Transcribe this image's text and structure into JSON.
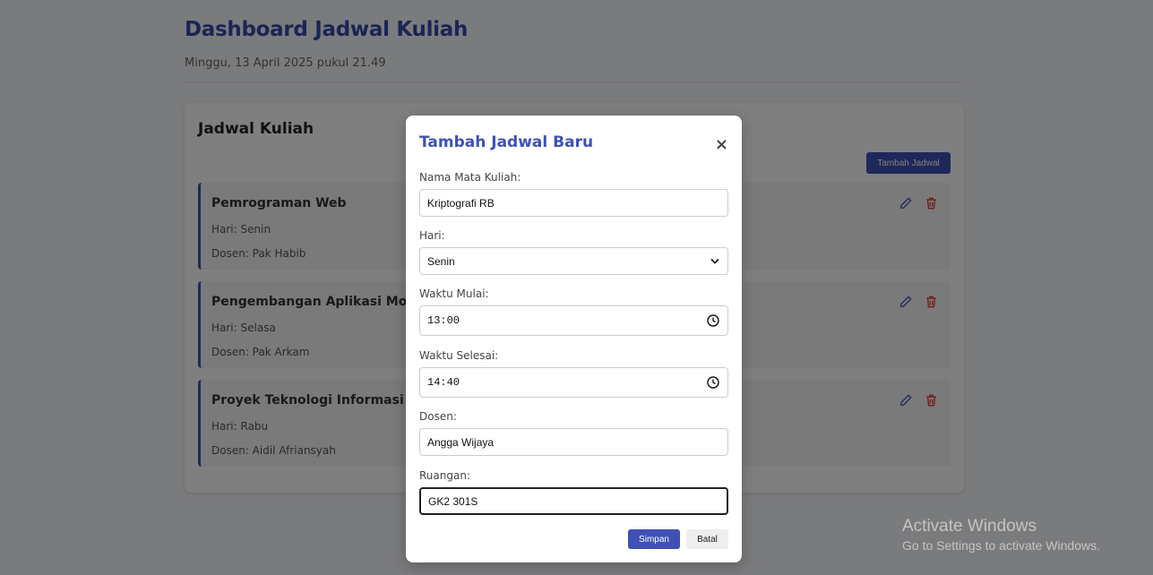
{
  "header": {
    "title": "Dashboard Jadwal Kuliah",
    "datetime": "Minggu, 13 April 2025 pukul 21.49"
  },
  "schedule": {
    "title": "Jadwal Kuliah",
    "add_label": "Tambah Jadwal",
    "items": [
      {
        "name": "Pemrograman Web",
        "day": "Hari: Senin",
        "lecturer": "Dosen: Pak Habib"
      },
      {
        "name": "Pengembangan Aplikasi Mobile",
        "day": "Hari: Selasa",
        "lecturer": "Dosen: Pak Arkam"
      },
      {
        "name": "Proyek Teknologi Informasi",
        "day": "Hari: Rabu",
        "lecturer": "Dosen: Aidil Afriansyah"
      }
    ]
  },
  "modal": {
    "title": "Tambah Jadwal Baru",
    "close_glyph": "×",
    "course_label": "Nama Mata Kuliah:",
    "course_value": "Kriptografi RB",
    "day_label": "Hari:",
    "day_value": "Senin",
    "start_label": "Waktu Mulai:",
    "start_value": "13:00",
    "end_label": "Waktu Selesai:",
    "end_value": "14:40",
    "lecturer_label": "Dosen:",
    "lecturer_value": "Angga Wijaya",
    "room_label": "Ruangan:",
    "room_value": "GK2 301S",
    "save_label": "Simpan",
    "cancel_label": "Batal"
  },
  "watermark": {
    "line1": "Activate Windows",
    "line2": "Go to Settings to activate Windows."
  },
  "colors": {
    "accent": "#3f51b5",
    "title": "#3949ab",
    "danger": "#e53935"
  },
  "icons": {
    "edit": "pencil-icon",
    "delete": "trash-icon",
    "close": "close-icon",
    "select": "chevron-down-icon",
    "time": "clock-icon"
  }
}
